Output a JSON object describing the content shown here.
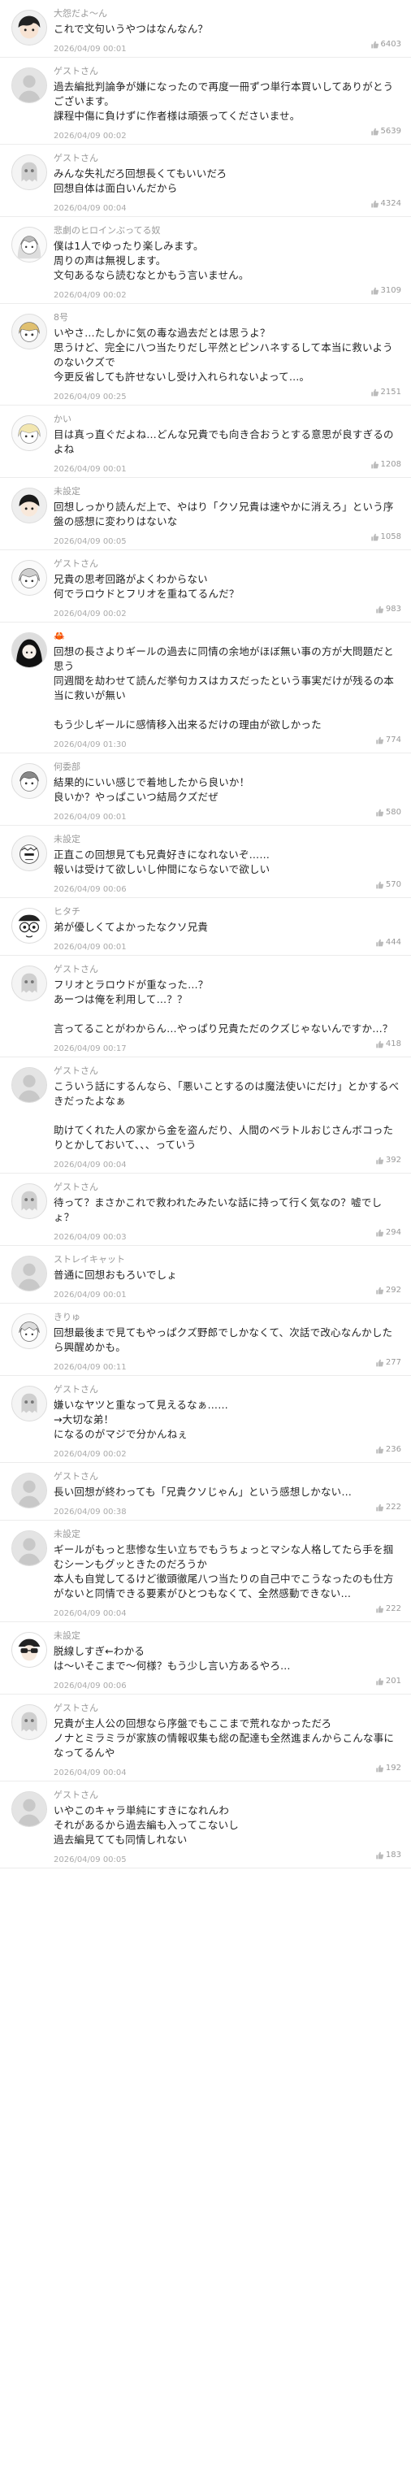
{
  "comments": [
    {
      "name": "大怨だよ〜ん",
      "text": "これで文句いうやつはなんなん？",
      "date": "2026/04/09 00:01",
      "likes": "6403",
      "avatar": "dark-hair-boy"
    },
    {
      "name": "ゲストさん",
      "text": "過去編批判論争が嫌になったので再度一冊ずつ単行本買いしてありがとうございます。\n課程中傷に負けずに作者様は頑張ってくださいませ。",
      "date": "2026/04/09 00:02",
      "likes": "5639",
      "avatar": "default"
    },
    {
      "name": "ゲストさん",
      "text": "みんな失礼だろ回想長くてもいいだろ\n回想自体は面白いんだから",
      "date": "2026/04/09 00:04",
      "likes": "4324",
      "avatar": "ghost"
    },
    {
      "name": "悲劇のヒロインぶってる奴",
      "text": "僕は1人でゆったり楽しみます。\n周りの声は無視します。\n文句あるなら読むなとかもう言いません。",
      "date": "2026/04/09 00:02",
      "likes": "3109",
      "avatar": "manga-girl"
    },
    {
      "name": "8号",
      "text": "いやさ…たしかに気の毒な過去だとは思うよ？\n思うけど、完全に八つ当たりだし平然とピンハネするして本当に救いようのないクズで\n今更反省しても許せないし受け入れられないよって…。",
      "date": "2026/04/09 00:25",
      "likes": "2151",
      "avatar": "manga-girl2"
    },
    {
      "name": "かい",
      "text": "目は真っ直ぐだよね…どんな兄貴でも向き合おうとする意思が良すぎるのよね",
      "date": "2026/04/09 00:01",
      "likes": "1208",
      "avatar": "blonde"
    },
    {
      "name": "未設定",
      "text": "回想しっかり読んだ上で、やはり「クソ兄貴は速やかに消えろ」という序盤の感想に変わりはないな",
      "date": "2026/04/09 00:05",
      "likes": "1058",
      "avatar": "dark-hair"
    },
    {
      "name": "ゲストさん",
      "text": "兄貴の思考回路がよくわからない\n何でラロウドとフリオを重ねてるんだ？",
      "date": "2026/04/09 00:02",
      "likes": "983",
      "avatar": "manga-girl3"
    },
    {
      "name": "🦀",
      "text": "回想の長さよりギールの過去に同情の余地がほぼ無い事の方が大問題だと思う\n同週間を劫わせて読んだ挙句カスはカスだったという事実だけが残るの本当に救いが無い\n\nもう少しギールに感情移入出来るだけの理由が欲しかった",
      "date": "2026/04/09 01:30",
      "likes": "774",
      "avatar": "dark-girl"
    },
    {
      "name": "何委部",
      "text": "結果的にいい感じで着地したから良いか！\n良いか？やっぱこいつ結局クズだぜ",
      "date": "2026/04/09 00:01",
      "likes": "580",
      "avatar": "manga-man"
    },
    {
      "name": "未設定",
      "text": "正直この回想見ても兄貴好きになれないぞ……\n報いは受けて欲しいし仲間にならないで欲しい",
      "date": "2026/04/09 00:06",
      "likes": "570",
      "avatar": "monk"
    },
    {
      "name": "ヒタチ",
      "text": "弟が優しくてよかったなクソ兄貴",
      "date": "2026/04/09 00:01",
      "likes": "444",
      "avatar": "cartoon-face"
    },
    {
      "name": "ゲストさん",
      "text": "フリオとラロウドが重なった…？\nあーつは俺を利用して…？？\n\n言ってることがわからん…やっぱり兄貴ただのクズじゃないんですか…？",
      "date": "2026/04/09 00:17",
      "likes": "418",
      "avatar": "ghost"
    },
    {
      "name": "ゲストさん",
      "text": "こういう話にするんなら、「悪いことするのは魔法使いにだけ」とかするべきだったよなぁ\n\n助けてくれた人の家から金を盗んだり、人間のベラトルおじさんボコったりとかしておいて、、、っていう",
      "date": "2026/04/09 00:04",
      "likes": "392",
      "avatar": "default"
    },
    {
      "name": "ゲストさん",
      "text": "待って？まさかこれで救われたみたいな話に持って行く気なの？嘘でしょ？",
      "date": "2026/04/09 00:03",
      "likes": "294",
      "avatar": "ghost"
    },
    {
      "name": "ストレイキャット",
      "text": "普通に回想おもろいでしょ",
      "date": "2026/04/09 00:01",
      "likes": "292",
      "avatar": "default"
    },
    {
      "name": "きりゅ",
      "text": "回想最後まで見てもやっぱクズ野郎でしかなくて、次話で改心なんかしたら興醒めかも。",
      "date": "2026/04/09 00:11",
      "likes": "277",
      "avatar": "sketch"
    },
    {
      "name": "ゲストさん",
      "text": "嫌いなヤツと重なって見えるなぁ……\n→大切な弟！\nになるのがマジで分かんねぇ",
      "date": "2026/04/09 00:02",
      "likes": "236",
      "avatar": "ghost"
    },
    {
      "name": "ゲストさん",
      "text": "長い回想が終わっても「兄貴クソじゃん」という感想しかない…",
      "date": "2026/04/09 00:38",
      "likes": "222",
      "avatar": "default"
    },
    {
      "name": "未設定",
      "text": "ギールがもっと悲惨な生い立ちでもうちょっとマシな人格してたら手を掴むシーンもグッときたのだろうか\n本人も自覚してるけど徹頭徹尾八つ当たりの自己中でこうなったのも仕方がないと同情できる要素がひとつもなくて、全然感動できない…",
      "date": "2026/04/09 00:04",
      "likes": "222",
      "avatar": "default"
    },
    {
      "name": "未設定",
      "text": "脱線しすぎ←わかる\nは～いそこまで～何様？もう少し言い方あるやろ…",
      "date": "2026/04/09 00:06",
      "likes": "201",
      "avatar": "glasses"
    },
    {
      "name": "ゲストさん",
      "text": "兄貴が主人公の回想なら序盤でもここまで荒れなかっただろ\nノナとミラミラが家族の情報収集も総の配達も全然進まんからこんな事になってるんや",
      "date": "2026/04/09 00:04",
      "likes": "192",
      "avatar": "ghost"
    },
    {
      "name": "ゲストさん",
      "text": "いやこのキャラ単純にすきになれんわ\nそれがあるから過去編も入ってこないし\n過去編見てても同情しれない",
      "date": "2026/04/09 00:05",
      "likes": "183",
      "avatar": "default"
    }
  ]
}
